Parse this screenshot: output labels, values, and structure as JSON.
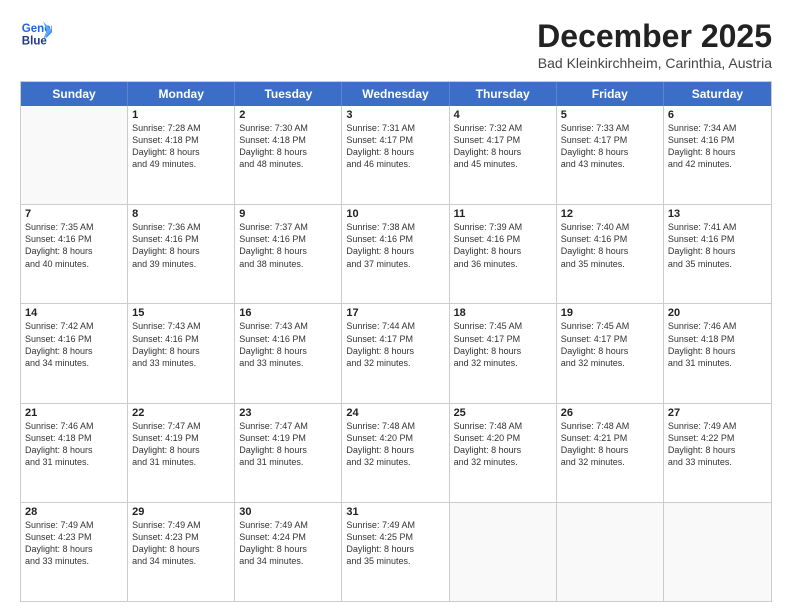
{
  "logo": {
    "line1": "General",
    "line2": "Blue"
  },
  "title": "December 2025",
  "location": "Bad Kleinkirchheim, Carinthia, Austria",
  "weekdays": [
    "Sunday",
    "Monday",
    "Tuesday",
    "Wednesday",
    "Thursday",
    "Friday",
    "Saturday"
  ],
  "weeks": [
    [
      {
        "day": "",
        "sunrise": "",
        "sunset": "",
        "daylight": "",
        "empty": true
      },
      {
        "day": "1",
        "sunrise": "Sunrise: 7:28 AM",
        "sunset": "Sunset: 4:18 PM",
        "daylight": "Daylight: 8 hours",
        "daylight2": "and 49 minutes."
      },
      {
        "day": "2",
        "sunrise": "Sunrise: 7:30 AM",
        "sunset": "Sunset: 4:18 PM",
        "daylight": "Daylight: 8 hours",
        "daylight2": "and 48 minutes."
      },
      {
        "day": "3",
        "sunrise": "Sunrise: 7:31 AM",
        "sunset": "Sunset: 4:17 PM",
        "daylight": "Daylight: 8 hours",
        "daylight2": "and 46 minutes."
      },
      {
        "day": "4",
        "sunrise": "Sunrise: 7:32 AM",
        "sunset": "Sunset: 4:17 PM",
        "daylight": "Daylight: 8 hours",
        "daylight2": "and 45 minutes."
      },
      {
        "day": "5",
        "sunrise": "Sunrise: 7:33 AM",
        "sunset": "Sunset: 4:17 PM",
        "daylight": "Daylight: 8 hours",
        "daylight2": "and 43 minutes."
      },
      {
        "day": "6",
        "sunrise": "Sunrise: 7:34 AM",
        "sunset": "Sunset: 4:16 PM",
        "daylight": "Daylight: 8 hours",
        "daylight2": "and 42 minutes."
      }
    ],
    [
      {
        "day": "7",
        "sunrise": "Sunrise: 7:35 AM",
        "sunset": "Sunset: 4:16 PM",
        "daylight": "Daylight: 8 hours",
        "daylight2": "and 40 minutes."
      },
      {
        "day": "8",
        "sunrise": "Sunrise: 7:36 AM",
        "sunset": "Sunset: 4:16 PM",
        "daylight": "Daylight: 8 hours",
        "daylight2": "and 39 minutes."
      },
      {
        "day": "9",
        "sunrise": "Sunrise: 7:37 AM",
        "sunset": "Sunset: 4:16 PM",
        "daylight": "Daylight: 8 hours",
        "daylight2": "and 38 minutes."
      },
      {
        "day": "10",
        "sunrise": "Sunrise: 7:38 AM",
        "sunset": "Sunset: 4:16 PM",
        "daylight": "Daylight: 8 hours",
        "daylight2": "and 37 minutes."
      },
      {
        "day": "11",
        "sunrise": "Sunrise: 7:39 AM",
        "sunset": "Sunset: 4:16 PM",
        "daylight": "Daylight: 8 hours",
        "daylight2": "and 36 minutes."
      },
      {
        "day": "12",
        "sunrise": "Sunrise: 7:40 AM",
        "sunset": "Sunset: 4:16 PM",
        "daylight": "Daylight: 8 hours",
        "daylight2": "and 35 minutes."
      },
      {
        "day": "13",
        "sunrise": "Sunrise: 7:41 AM",
        "sunset": "Sunset: 4:16 PM",
        "daylight": "Daylight: 8 hours",
        "daylight2": "and 35 minutes."
      }
    ],
    [
      {
        "day": "14",
        "sunrise": "Sunrise: 7:42 AM",
        "sunset": "Sunset: 4:16 PM",
        "daylight": "Daylight: 8 hours",
        "daylight2": "and 34 minutes."
      },
      {
        "day": "15",
        "sunrise": "Sunrise: 7:43 AM",
        "sunset": "Sunset: 4:16 PM",
        "daylight": "Daylight: 8 hours",
        "daylight2": "and 33 minutes."
      },
      {
        "day": "16",
        "sunrise": "Sunrise: 7:43 AM",
        "sunset": "Sunset: 4:16 PM",
        "daylight": "Daylight: 8 hours",
        "daylight2": "and 33 minutes."
      },
      {
        "day": "17",
        "sunrise": "Sunrise: 7:44 AM",
        "sunset": "Sunset: 4:17 PM",
        "daylight": "Daylight: 8 hours",
        "daylight2": "and 32 minutes."
      },
      {
        "day": "18",
        "sunrise": "Sunrise: 7:45 AM",
        "sunset": "Sunset: 4:17 PM",
        "daylight": "Daylight: 8 hours",
        "daylight2": "and 32 minutes."
      },
      {
        "day": "19",
        "sunrise": "Sunrise: 7:45 AM",
        "sunset": "Sunset: 4:17 PM",
        "daylight": "Daylight: 8 hours",
        "daylight2": "and 32 minutes."
      },
      {
        "day": "20",
        "sunrise": "Sunrise: 7:46 AM",
        "sunset": "Sunset: 4:18 PM",
        "daylight": "Daylight: 8 hours",
        "daylight2": "and 31 minutes."
      }
    ],
    [
      {
        "day": "21",
        "sunrise": "Sunrise: 7:46 AM",
        "sunset": "Sunset: 4:18 PM",
        "daylight": "Daylight: 8 hours",
        "daylight2": "and 31 minutes."
      },
      {
        "day": "22",
        "sunrise": "Sunrise: 7:47 AM",
        "sunset": "Sunset: 4:19 PM",
        "daylight": "Daylight: 8 hours",
        "daylight2": "and 31 minutes."
      },
      {
        "day": "23",
        "sunrise": "Sunrise: 7:47 AM",
        "sunset": "Sunset: 4:19 PM",
        "daylight": "Daylight: 8 hours",
        "daylight2": "and 31 minutes."
      },
      {
        "day": "24",
        "sunrise": "Sunrise: 7:48 AM",
        "sunset": "Sunset: 4:20 PM",
        "daylight": "Daylight: 8 hours",
        "daylight2": "and 32 minutes."
      },
      {
        "day": "25",
        "sunrise": "Sunrise: 7:48 AM",
        "sunset": "Sunset: 4:20 PM",
        "daylight": "Daylight: 8 hours",
        "daylight2": "and 32 minutes."
      },
      {
        "day": "26",
        "sunrise": "Sunrise: 7:48 AM",
        "sunset": "Sunset: 4:21 PM",
        "daylight": "Daylight: 8 hours",
        "daylight2": "and 32 minutes."
      },
      {
        "day": "27",
        "sunrise": "Sunrise: 7:49 AM",
        "sunset": "Sunset: 4:22 PM",
        "daylight": "Daylight: 8 hours",
        "daylight2": "and 33 minutes."
      }
    ],
    [
      {
        "day": "28",
        "sunrise": "Sunrise: 7:49 AM",
        "sunset": "Sunset: 4:23 PM",
        "daylight": "Daylight: 8 hours",
        "daylight2": "and 33 minutes."
      },
      {
        "day": "29",
        "sunrise": "Sunrise: 7:49 AM",
        "sunset": "Sunset: 4:23 PM",
        "daylight": "Daylight: 8 hours",
        "daylight2": "and 34 minutes."
      },
      {
        "day": "30",
        "sunrise": "Sunrise: 7:49 AM",
        "sunset": "Sunset: 4:24 PM",
        "daylight": "Daylight: 8 hours",
        "daylight2": "and 34 minutes."
      },
      {
        "day": "31",
        "sunrise": "Sunrise: 7:49 AM",
        "sunset": "Sunset: 4:25 PM",
        "daylight": "Daylight: 8 hours",
        "daylight2": "and 35 minutes."
      },
      {
        "day": "",
        "sunrise": "",
        "sunset": "",
        "daylight": "",
        "daylight2": "",
        "empty": true
      },
      {
        "day": "",
        "sunrise": "",
        "sunset": "",
        "daylight": "",
        "daylight2": "",
        "empty": true
      },
      {
        "day": "",
        "sunrise": "",
        "sunset": "",
        "daylight": "",
        "daylight2": "",
        "empty": true
      }
    ]
  ]
}
